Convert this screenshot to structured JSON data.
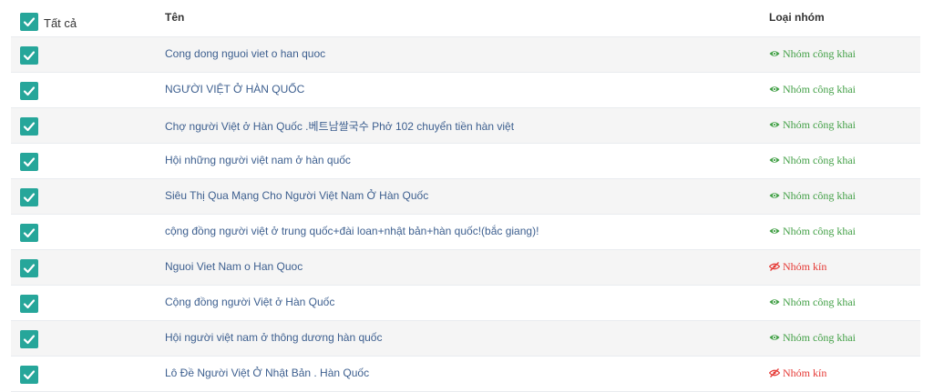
{
  "header": {
    "select_all_label": "Tất cả",
    "name_column": "Tên",
    "type_column": "Loại nhóm"
  },
  "colors": {
    "checkbox": "#26a69a",
    "public": "#43a047",
    "closed": "#e53935",
    "link": "#3d5f8f"
  },
  "rows": [
    {
      "name": "Cong dong nguoi viet o han quoc",
      "type": "Nhóm công khai",
      "kind": "public",
      "checked": true,
      "icon": "eye-icon"
    },
    {
      "name": "NGƯỜI VIỆT Ở HÀN QUỐC",
      "type": "Nhóm công khai",
      "kind": "public",
      "checked": true,
      "icon": "eye-icon"
    },
    {
      "name": "Chợ người Việt ở Hàn Quốc .베트남쌀국수 Phở 102 chuyển tiền hàn việt",
      "type": "Nhóm công khai",
      "kind": "public",
      "checked": true,
      "icon": "eye-icon"
    },
    {
      "name": "Hội những người việt nam ở hàn quốc",
      "type": "Nhóm công khai",
      "kind": "public",
      "checked": true,
      "icon": "eye-icon"
    },
    {
      "name": "Siêu Thị Qua Mạng Cho Người Việt Nam Ở Hàn Quốc",
      "type": "Nhóm công khai",
      "kind": "public",
      "checked": true,
      "icon": "eye-icon"
    },
    {
      "name": "cộng đồng người việt ở trung quốc+đài loan+nhật bản+hàn quốc!(bắc giang)!",
      "type": "Nhóm công khai",
      "kind": "public",
      "checked": true,
      "icon": "eye-icon"
    },
    {
      "name": "Nguoi Viet Nam o Han Quoc",
      "type": "Nhóm kín",
      "kind": "closed",
      "checked": true,
      "icon": "eye-slash-icon"
    },
    {
      "name": "Cộng đồng người Việt ở Hàn Quốc",
      "type": "Nhóm công khai",
      "kind": "public",
      "checked": true,
      "icon": "eye-icon"
    },
    {
      "name": "Hội người việt nam ở thông dương hàn quốc",
      "type": "Nhóm công khai",
      "kind": "public",
      "checked": true,
      "icon": "eye-icon"
    },
    {
      "name": "Lô Đề Người Việt Ở Nhật Bản . Hàn Quốc",
      "type": "Nhóm kín",
      "kind": "closed",
      "checked": true,
      "icon": "eye-slash-icon"
    }
  ]
}
